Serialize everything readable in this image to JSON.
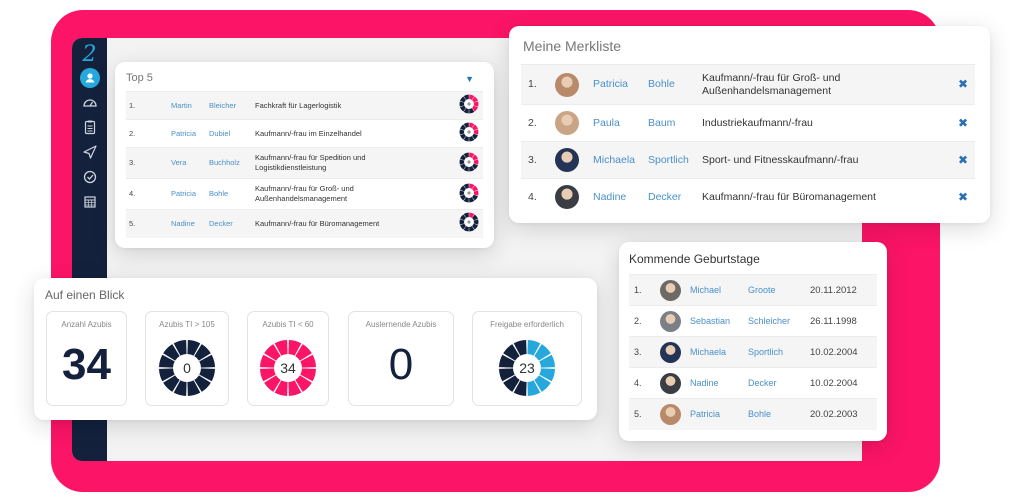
{
  "colors": {
    "brand_pink": "#fc1466",
    "navy": "#13213d",
    "accent_blue": "#27a8dc",
    "link_blue": "#4a90c9",
    "delete_blue": "#2b6fb4"
  },
  "sidebar": {
    "logo": "2",
    "items": [
      {
        "icon": "user-circle-icon",
        "active": true
      },
      {
        "icon": "dashboard-gauge-icon",
        "active": false
      },
      {
        "icon": "clipboard-list-icon",
        "active": false
      },
      {
        "icon": "send-icon",
        "active": false
      },
      {
        "icon": "check-circle-icon",
        "active": false
      },
      {
        "icon": "calendar-grid-icon",
        "active": false
      }
    ]
  },
  "top5": {
    "title": "Top 5",
    "toggle_icon": "caret-down-icon",
    "rows": [
      {
        "rank": "1.",
        "first": "Martin",
        "last": "Bleicher",
        "job": "Fachkraft für Lagerlogistik",
        "ring_pink_fraction": 0.35
      },
      {
        "rank": "2.",
        "first": "Patricia",
        "last": "Dubiel",
        "job": "Kaufmann/-frau im Einzelhandel",
        "ring_pink_fraction": 0.3
      },
      {
        "rank": "3.",
        "first": "Vera",
        "last": "Buchholz",
        "job_lines": [
          "Kaufmann/-frau für Spedition und",
          "Logistikdienstleistung"
        ],
        "ring_pink_fraction": 0.25
      },
      {
        "rank": "4.",
        "first": "Patricia",
        "last": "Bohle",
        "job_lines": [
          "Kaufmann/-frau für Groß- und",
          "Außenhandelsmanagement"
        ],
        "ring_pink_fraction": 0.25
      },
      {
        "rank": "5.",
        "first": "Nadine",
        "last": "Decker",
        "job": "Kaufmann/-frau für Büromanagement",
        "ring_pink_fraction": 0.1
      }
    ]
  },
  "merkliste": {
    "title": "Meine Merkliste",
    "remove_icon": "close-x-icon",
    "rows": [
      {
        "rank": "1.",
        "first": "Patricia",
        "last": "Bohle",
        "job_lines": [
          "Kaufmann/-frau für Groß- und",
          "Außenhandelsmanagement"
        ],
        "avatar_color": "#b98a6a"
      },
      {
        "rank": "2.",
        "first": "Paula",
        "last": "Baum",
        "job": "Industriekaufmann/-frau",
        "avatar_color": "#c9a585"
      },
      {
        "rank": "3.",
        "first": "Michaela",
        "last": "Sportlich",
        "job": "Sport- und Fitnesskaufmann/-frau",
        "avatar_color": "#243457"
      },
      {
        "rank": "4.",
        "first": "Nadine",
        "last": "Decker",
        "job": "Kaufmann/-frau für Büromanagement",
        "avatar_color": "#3b3d44"
      }
    ]
  },
  "geburtstage": {
    "title": "Kommende Geburtstage",
    "rows": [
      {
        "rank": "1.",
        "first": "Michael",
        "last": "Groote",
        "date": "20.11.2012",
        "avatar_color": "#6d6a66"
      },
      {
        "rank": "2.",
        "first": "Sebastian",
        "last": "Schleicher",
        "date": "26.11.1998",
        "avatar_color": "#7b7f86"
      },
      {
        "rank": "3.",
        "first": "Michaela",
        "last": "Sportlich",
        "date": "10.02.2004",
        "avatar_color": "#243457"
      },
      {
        "rank": "4.",
        "first": "Nadine",
        "last": "Decker",
        "date": "10.02.2004",
        "avatar_color": "#3b3d44"
      },
      {
        "rank": "5.",
        "first": "Patricia",
        "last": "Bohle",
        "date": "20.02.2003",
        "avatar_color": "#b98a6a"
      }
    ]
  },
  "blick": {
    "title": "Auf einen Blick",
    "kpis": [
      {
        "label": "Anzahl Azubis",
        "value": "34",
        "type": "number"
      },
      {
        "label": "Azubis TI > 105",
        "value": "0",
        "type": "ring",
        "ring_color": "#13213d"
      },
      {
        "label": "Azubis TI < 60",
        "value": "34",
        "type": "ring",
        "ring_color": "#fc1466"
      },
      {
        "label": "Auslernende Azubis",
        "value": "0",
        "type": "number"
      },
      {
        "label": "Freigabe erforderlich",
        "value": "23",
        "type": "ring_split",
        "ring_color": "#13213d",
        "highlight_color": "#27a8dc",
        "highlight_fraction": 0.5
      }
    ]
  }
}
